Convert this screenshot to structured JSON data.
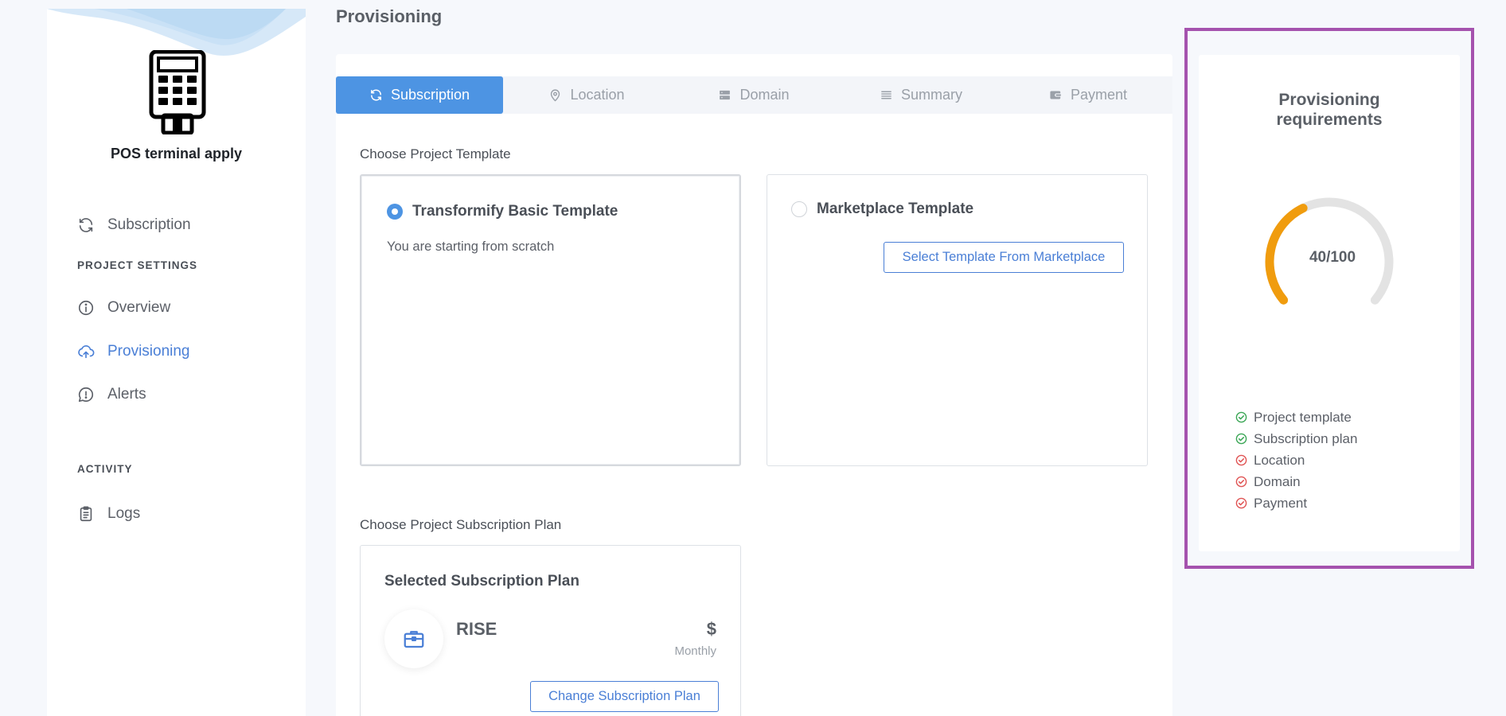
{
  "page_title": "Provisioning",
  "sidebar": {
    "app_name": "POS terminal apply",
    "items": [
      {
        "label": "Subscription",
        "icon": "refresh-icon"
      },
      {
        "label": "Overview",
        "icon": "info-icon"
      },
      {
        "label": "Provisioning",
        "icon": "cloud-upload-icon",
        "active": true
      },
      {
        "label": "Alerts",
        "icon": "chat-alert-icon"
      },
      {
        "label": "Logs",
        "icon": "clipboard-icon"
      }
    ],
    "sections": {
      "project_settings": "PROJECT SETTINGS",
      "activity": "ACTIVITY"
    }
  },
  "tabs": [
    {
      "label": "Subscription",
      "icon": "refresh-icon",
      "active": true
    },
    {
      "label": "Location",
      "icon": "map-pin-icon"
    },
    {
      "label": "Domain",
      "icon": "server-icon"
    },
    {
      "label": "Summary",
      "icon": "list-icon"
    },
    {
      "label": "Payment",
      "icon": "wallet-icon"
    }
  ],
  "template_section": {
    "label": "Choose Project Template",
    "basic": {
      "title": "Transformify Basic Template",
      "description": "You are starting from scratch",
      "selected": true
    },
    "marketplace": {
      "title": "Marketplace Template",
      "button": "Select Template From Marketplace",
      "selected": false
    }
  },
  "plan_section": {
    "label": "Choose Project Subscription Plan",
    "heading": "Selected Subscription Plan",
    "plan_name": "RISE",
    "price": "$",
    "period": "Monthly",
    "change_button": "Change Subscription Plan"
  },
  "requirements": {
    "title_line1": "Provisioning",
    "title_line2": "requirements",
    "progress_label": "40/100",
    "progress": 40,
    "items": [
      {
        "label": "Project template",
        "done": true
      },
      {
        "label": "Subscription plan",
        "done": true
      },
      {
        "label": "Location",
        "done": false
      },
      {
        "label": "Domain",
        "done": false
      },
      {
        "label": "Payment",
        "done": false
      }
    ]
  },
  "colors": {
    "accent": "#4d94e3",
    "link": "#4a7fd6",
    "gauge_fill": "#f09c0e",
    "gauge_track": "#e3e3e3",
    "done": "#3aa655",
    "pending": "#e05353",
    "highlight_frame": "#a552ae"
  }
}
